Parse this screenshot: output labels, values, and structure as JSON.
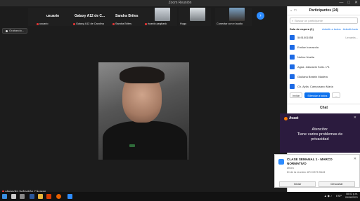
{
  "window": {
    "title": "Zoom Reunión",
    "controls": {
      "minimize": "—",
      "maximize": "□",
      "close": "✕"
    }
  },
  "gallery": {
    "tiles": [
      {
        "name": "usuario",
        "label": "usuario"
      },
      {
        "name": "Galaxy A12 de C...",
        "label": "Galaxy A12 de Carolina"
      },
      {
        "name": "Sandra Brites",
        "label": "Sandra Brites"
      },
      {
        "name": "",
        "label": "ricardo pegbank"
      },
      {
        "name": "",
        "label": "Hugo"
      },
      {
        "name": "",
        "label": "Conectar con el audio"
      }
    ],
    "next_icon": "chevron-right-icon",
    "next_glyph": "›"
  },
  "recording": {
    "label": "Grabando..."
  },
  "active_speaker": {
    "name": "Alejandro Sebastián Cáceres"
  },
  "participants": {
    "title": "Participantes (24)",
    "search_placeholder": "Buscar un participante",
    "waiting_room": {
      "label": "Sala de espera (1)",
      "admit_all": "Admitir a todos",
      "admit": "Admitir todo"
    },
    "list": [
      {
        "name": "5491001058",
        "tail": "Levanta..."
      },
      {
        "name": "Emilce Irarrazola",
        "tail": ""
      },
      {
        "name": "Nuñez Noelia",
        "tail": ""
      },
      {
        "name": "Agda. Zdanavik Solis. 1º1",
        "tail": ""
      },
      {
        "name": "Giuliana Beatriz Madera",
        "tail": ""
      },
      {
        "name": "Ch. Aylia. Campusano María",
        "tail": ""
      }
    ],
    "buttons": {
      "invite": "Invitar",
      "mute_all": "Silenciar a todos",
      "more": "..."
    }
  },
  "chat": {
    "title": "Chat"
  },
  "avast": {
    "brand": "Avast",
    "message_line1": "Atención:",
    "message_line2": "Tiene varios problemas de",
    "message_line3": "privacidad",
    "close": "✕"
  },
  "zoom_notification": {
    "title": "CLASE SEMANAL 1 - MARCO NORMATIVO",
    "time": "ahora",
    "meeting_id": "ID de la reunión: 873 0375 9643",
    "join": "Iniciar",
    "dismiss": "Descartar",
    "close": "✕"
  },
  "taskbar": {
    "lang": "ESP",
    "clock": "08:02 p.m.",
    "date": "09/06/2021",
    "sys_icons": "▲ ◆ ♪"
  }
}
